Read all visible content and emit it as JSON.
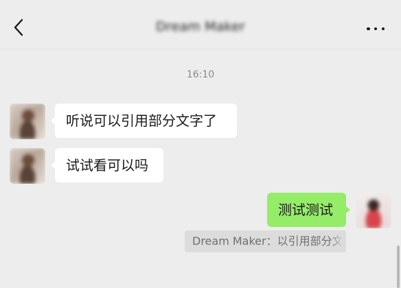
{
  "header": {
    "back_icon": "chevron-left-icon",
    "title": "Dream Maker",
    "more_icon": "ellipsis-icon"
  },
  "timestamp": "16:10",
  "messages": [
    {
      "side": "left",
      "text": "听说可以引用部分文字了"
    },
    {
      "side": "left",
      "text": "试试看可以吗"
    },
    {
      "side": "right",
      "text": "测试测试"
    }
  ],
  "quote": {
    "text": "Dream Maker：以引用部分文"
  },
  "colors": {
    "background": "#ededed",
    "incoming_bubble": "#ffffff",
    "outgoing_bubble": "#95ec69",
    "quote_background": "#dcdcdc"
  }
}
